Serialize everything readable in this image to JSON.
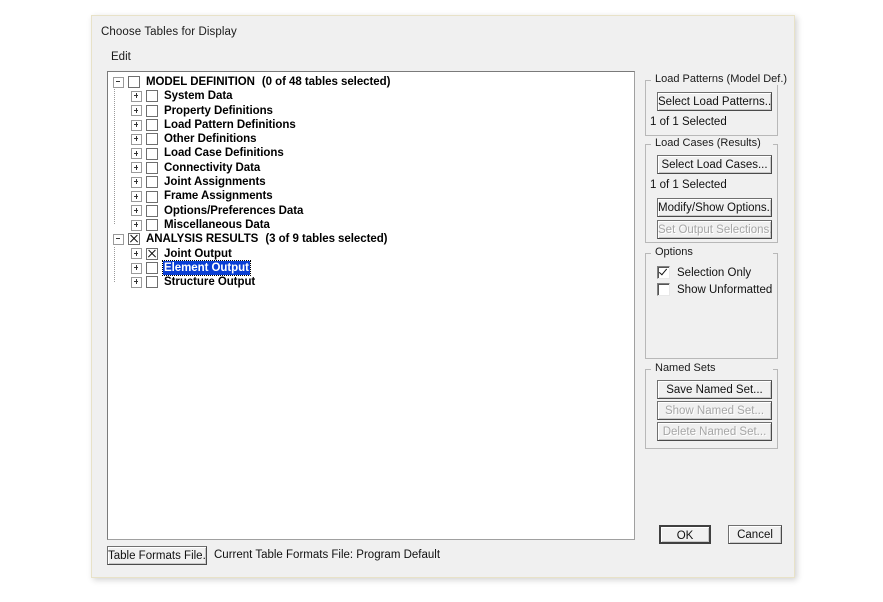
{
  "window": {
    "title": "Choose Tables for Display",
    "menu": [
      {
        "label": "Edit"
      }
    ]
  },
  "tree": {
    "nodes": [
      {
        "label": "MODEL DEFINITION",
        "count": "(0 of 48 tables selected)",
        "level": 0,
        "check": "empty",
        "expander": "minus"
      },
      {
        "label": "System Data",
        "count": "",
        "level": 1,
        "check": "empty",
        "expander": "plus"
      },
      {
        "label": "Property Definitions",
        "count": "",
        "level": 1,
        "check": "empty",
        "expander": "plus"
      },
      {
        "label": "Load Pattern Definitions",
        "count": "",
        "level": 1,
        "check": "empty",
        "expander": "plus"
      },
      {
        "label": "Other Definitions",
        "count": "",
        "level": 1,
        "check": "empty",
        "expander": "plus"
      },
      {
        "label": "Load Case Definitions",
        "count": "",
        "level": 1,
        "check": "empty",
        "expander": "plus"
      },
      {
        "label": "Connectivity Data",
        "count": "",
        "level": 1,
        "check": "empty",
        "expander": "plus"
      },
      {
        "label": "Joint Assignments",
        "count": "",
        "level": 1,
        "check": "empty",
        "expander": "plus"
      },
      {
        "label": "Frame Assignments",
        "count": "",
        "level": 1,
        "check": "empty",
        "expander": "plus"
      },
      {
        "label": "Options/Preferences Data",
        "count": "",
        "level": 1,
        "check": "empty",
        "expander": "plus"
      },
      {
        "label": "Miscellaneous Data",
        "count": "",
        "level": 1,
        "check": "empty",
        "expander": "plus"
      },
      {
        "label": "ANALYSIS RESULTS",
        "count": "(3 of 9 tables selected)",
        "level": 0,
        "check": "x",
        "expander": "minus"
      },
      {
        "label": "Joint Output",
        "count": "",
        "level": 1,
        "check": "x",
        "expander": "plus"
      },
      {
        "label": "Element Output",
        "count": "",
        "level": 1,
        "check": "empty",
        "expander": "plus",
        "selected": true
      },
      {
        "label": "Structure Output",
        "count": "",
        "level": 1,
        "check": "empty",
        "expander": "plus"
      }
    ]
  },
  "load_patterns_group": {
    "title": "Load Patterns (Model Def.)",
    "select_button": "Select Load Patterns...",
    "status": "1 of 1 Selected"
  },
  "load_cases_group": {
    "title": "Load Cases (Results)",
    "select_button": "Select Load Cases...",
    "status": "1 of 1 Selected",
    "modify_button": "Modify/Show Options...",
    "output_button": "Set Output Selections..."
  },
  "options_group": {
    "title": "Options",
    "items": [
      {
        "label": "Selection Only",
        "checked": true
      },
      {
        "label": "Show Unformatted",
        "checked": false
      }
    ]
  },
  "named_sets_group": {
    "title": "Named Sets",
    "save_button": "Save Named Set...",
    "show_button": "Show Named Set...",
    "delete_button": "Delete Named Set..."
  },
  "footer": {
    "table_formats_button": "Table Formats File...",
    "current_file_text": "Current Table Formats File:  Program Default"
  },
  "actions": {
    "ok": "OK",
    "cancel": "Cancel"
  },
  "colors": {
    "dialog_bg": "#f0f0f0",
    "tree_bg": "#ffffff",
    "selection_blue": "#0a3fd4",
    "border_cream": "#e8e2c8",
    "disabled_text": "#a6a6a6"
  }
}
